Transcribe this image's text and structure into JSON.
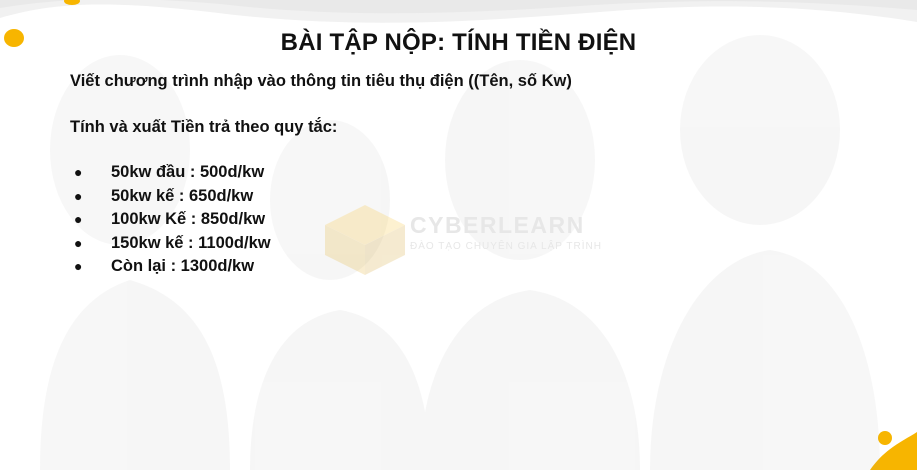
{
  "slide": {
    "title": "BÀI TẬP NỘP: TÍNH TIỀN ĐIỆN",
    "intro": "Viết chương trình nhập vào thông tin tiêu thụ điện ((Tên, số Kw)",
    "rule_intro": "Tính và xuất Tiền trả theo quy tắc:",
    "rules": [
      "50kw đầu : 500d/kw",
      "50kw kế : 650d/kw",
      "100kw Kế : 850d/kw",
      "150kw kế : 1100d/kw",
      "Còn lại : 1300d/kw"
    ],
    "bullet": "●"
  },
  "watermark": {
    "brand": "CYBERLEARN",
    "tagline": "ĐÀO TẠO CHUYÊN GIA LẬP TRÌNH"
  },
  "colors": {
    "accent": "#f7b500",
    "text": "#111111",
    "watermark": "#e7e7e7"
  }
}
